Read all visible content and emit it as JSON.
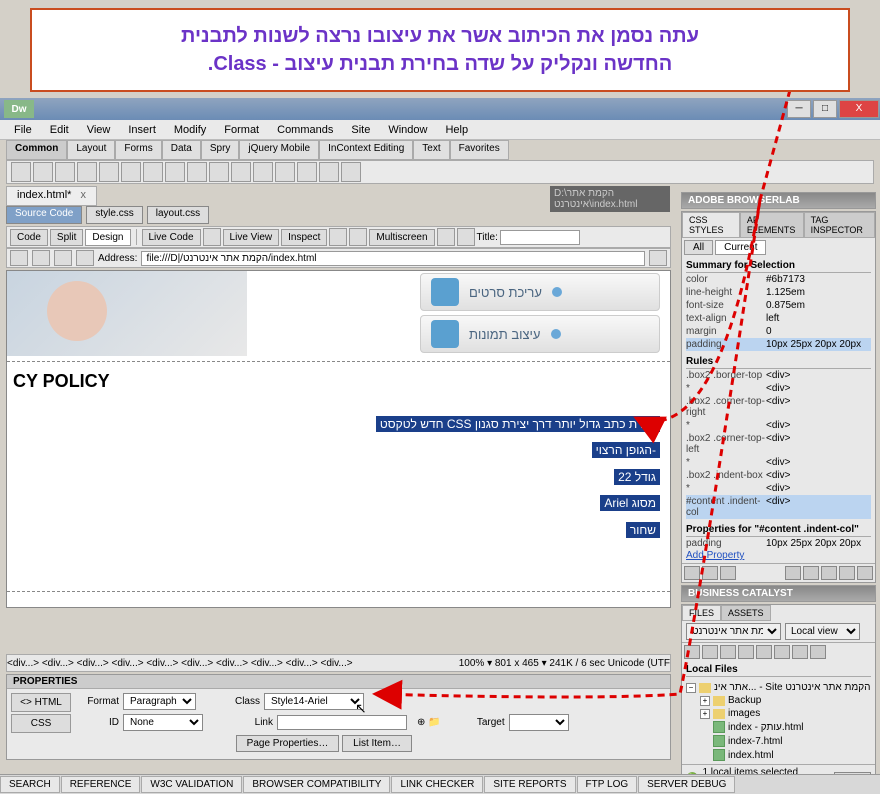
{
  "callout": {
    "line1": "עתה נסמן את הכיתוב אשר את עיצובו נרצה לשנות לתבנית",
    "line2": "החדשה ונקליק על שדה בחירת תבנית עיצוב - Class."
  },
  "dw_logo": "Dw",
  "window_buttons": {
    "min": "─",
    "max": "□",
    "close": "X"
  },
  "menubar": [
    "File",
    "Edit",
    "View",
    "Insert",
    "Modify",
    "Format",
    "Commands",
    "Site",
    "Window",
    "Help"
  ],
  "insert_tabs": [
    "Common",
    "Layout",
    "Forms",
    "Data",
    "Spry",
    "jQuery Mobile",
    "InContext Editing",
    "Text",
    "Favorites"
  ],
  "doc_tab": {
    "name": "index.html*",
    "close": "x"
  },
  "doc_path": "D:\\הקמת אתר אינטרנט\\index.html",
  "src_tabs": [
    "Source Code",
    "style.css",
    "layout.css"
  ],
  "doc_toolbar": {
    "code": "Code",
    "split": "Split",
    "design": "Design",
    "livecode": "Live Code",
    "liveview": "Live View",
    "inspect": "Inspect",
    "multiscreen": "Multiscreen",
    "title_label": "Title:",
    "title_value": ""
  },
  "addr": {
    "label": "Address:",
    "value": "file:///D|/הקמת אתר אינטרנט/index.html"
  },
  "design": {
    "nav1": "עריכת סרטים",
    "nav2": "עיצוב תמונות",
    "heading": "CY POLICY",
    "lines": [
      "יצירת כתב גדול יותר דרך יצירת סגנון CSS חדש לטקסט",
      "-הגופן הרצוי",
      "גודל 22",
      "מסוג Ariel",
      "שחור"
    ]
  },
  "tag_selector": {
    "tags": "<div...> <div...> <div...> <div...> <div...> <div...> <div...> <div...> <div...> <div...>",
    "zoom": "100%",
    "dims": "801 x 465",
    "stats": "241K / 6 sec Unicode (UTF"
  },
  "properties": {
    "title": "PROPERTIES",
    "html_btn": "<> HTML",
    "css_btn": "CSS",
    "format_label": "Format",
    "format_value": "Paragraph",
    "id_label": "ID",
    "id_value": "None",
    "class_label": "Class",
    "class_value": "Style14-Ariel",
    "link_label": "Link",
    "link_value": "",
    "target_label": "Target",
    "target_value": "",
    "page_props_btn": "Page Properties…",
    "list_item_btn": "List Item…"
  },
  "statusbar": [
    "SEARCH",
    "REFERENCE",
    "W3C VALIDATION",
    "BROWSER COMPATIBILITY",
    "LINK CHECKER",
    "SITE REPORTS",
    "FTP LOG",
    "SERVER DEBUG"
  ],
  "panels": {
    "browserlab": "ADOBE BROWSERLAB",
    "css_tabs": [
      "CSS STYLES",
      "AP ELEMENTS",
      "TAG INSPECTOR"
    ],
    "css_subtabs": [
      "All",
      "Current"
    ],
    "summary_title": "Summary for Selection",
    "summary": [
      {
        "k": "color",
        "v": "#6b7173"
      },
      {
        "k": "line-height",
        "v": "1.125em"
      },
      {
        "k": "font-size",
        "v": "0.875em"
      },
      {
        "k": "text-align",
        "v": "left"
      },
      {
        "k": "margin",
        "v": "0"
      },
      {
        "k": "padding",
        "v": "10px 25px 20px 20px"
      }
    ],
    "rules_title": "Rules",
    "rules": [
      {
        "k": ".box2 .border-top",
        "v": "<div>"
      },
      {
        "k": "*",
        "v": "<div>"
      },
      {
        "k": ".box2 .corner-top-right",
        "v": "<div>"
      },
      {
        "k": "*",
        "v": "<div>"
      },
      {
        "k": ".box2 .corner-top-left",
        "v": "<div>"
      },
      {
        "k": "*",
        "v": "<div>"
      },
      {
        "k": ".box2 .indent-box",
        "v": "<div>"
      },
      {
        "k": "*",
        "v": "<div>"
      },
      {
        "k": "#content .indent-col",
        "v": "<div>"
      }
    ],
    "props_for_title": "Properties for \"#content .indent-col\"",
    "props_for": [
      {
        "k": "padding",
        "v": "10px 25px 20px 20px"
      }
    ],
    "add_property": "Add Property",
    "biz_catalyst": "BUSINESS CATALYST",
    "files_tabs": [
      "FILES",
      "ASSETS"
    ],
    "site_select": "מת אתר אינטרנט",
    "view_select": "Local view",
    "local_files_title": "Local Files",
    "tree": {
      "root": "אתר אינ... - Site הקמת אתר אינטרנט",
      "items": [
        "Backup",
        "images",
        "index - עותק.html",
        "index-7.html",
        "index.html"
      ]
    },
    "files_status": "1 local items selected totalling",
    "log_btn": "Log…"
  }
}
